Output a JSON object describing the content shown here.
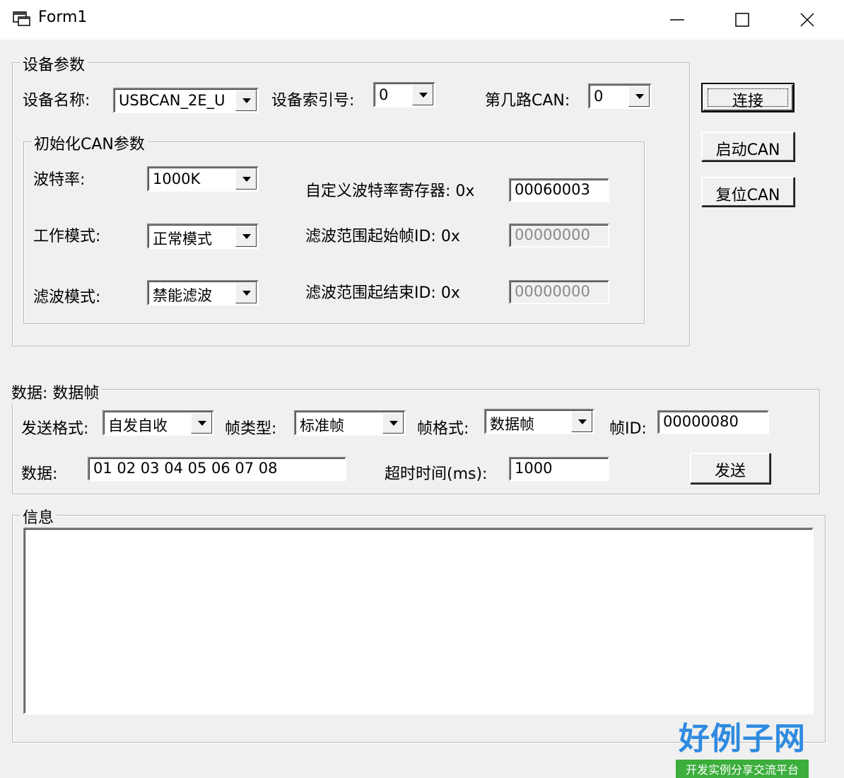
{
  "window": {
    "title": "Form1"
  },
  "device_group": {
    "title": "设备参数",
    "device_name_label": "设备名称:",
    "device_name_value": "USBCAN_2E_U",
    "device_index_label": "设备索引号:",
    "device_index_value": "0",
    "can_channel_label": "第几路CAN:",
    "can_channel_value": "0"
  },
  "init_group": {
    "title": "初始化CAN参数",
    "baud_label": "波特率:",
    "baud_value": "1000K",
    "mode_label": "工作模式:",
    "mode_value": "正常模式",
    "filter_label": "滤波模式:",
    "filter_value": "禁能滤波",
    "custom_baud_label": "自定义波特率寄存器: 0x",
    "custom_baud_value": "00060003",
    "filter_start_label": "滤波范围起始帧ID: 0x",
    "filter_start_value": "00000000",
    "filter_end_label": "滤波范围起结束ID: 0x",
    "filter_end_value": "00000000"
  },
  "buttons": {
    "connect": "连接",
    "start_can": "启动CAN",
    "reset_can": "复位CAN",
    "send": "发送"
  },
  "data_group": {
    "title": "数据: 数据帧",
    "send_format_label": "发送格式:",
    "send_format_value": "自发自收",
    "frame_type_label": "帧类型:",
    "frame_type_value": "标准帧",
    "frame_format_label": "帧格式:",
    "frame_format_value": "数据帧",
    "frame_id_label": "帧ID:",
    "frame_id_value": "00000080",
    "data_label": "数据:",
    "data_value": "01 02 03 04 05 06 07 08",
    "timeout_label": "超时时间(ms):",
    "timeout_value": "1000"
  },
  "info_group": {
    "title": "信息"
  },
  "watermark": {
    "brand": "好例子网",
    "slogan": "开发实例分享交流平台"
  },
  "colors": {
    "window_bg": "#f0f0f0",
    "titlebar_bg": "#ffffff",
    "watermark_blue": "#2e8be0",
    "watermark_green": "#3cae3c"
  }
}
